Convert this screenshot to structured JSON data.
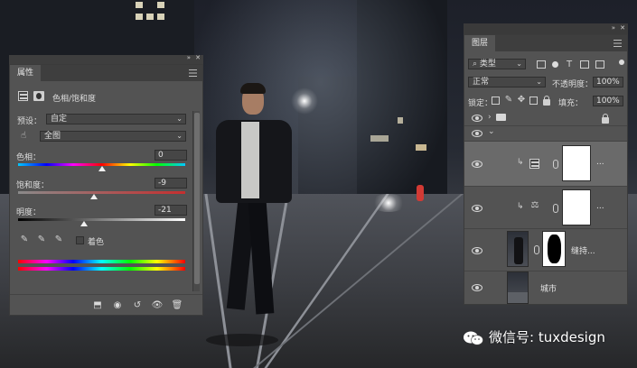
{
  "properties_panel": {
    "tab_label": "属性",
    "adjustment_name": "色相/饱和度",
    "preset_label": "预设：",
    "preset_value": "自定",
    "channel_value": "全图",
    "hue_label": "色相：",
    "hue_value": "0",
    "hue_level": 0.5,
    "saturation_label": "饱和度：",
    "saturation_value": "-9",
    "saturation_level": 0.455,
    "lightness_label": "明度：",
    "lightness_value": "-21",
    "lightness_level": 0.395,
    "colorize_label": "着色",
    "colorize_checked": false,
    "colors": {
      "panel_bg": "#535353",
      "tab_bar": "#3e3e3e",
      "field_bg": "#464646"
    },
    "icons": [
      "hue-saturation-adjustment-icon",
      "mask-icon",
      "target-adjust-hand-icon",
      "eyedropper-icon",
      "eyedropper-plus-icon",
      "eyedropper-minus-icon",
      "clip-to-layer-icon",
      "view-previous-state-icon",
      "reset-icon",
      "visibility-icon",
      "delete-icon"
    ]
  },
  "layers_panel": {
    "tab_label": "图层",
    "filter_kind": "类型",
    "blend_mode": "正常",
    "opacity_label": "不透明度：",
    "opacity_value": "100%",
    "lock_label": "锁定：",
    "fill_label": "填充：",
    "fill_value": "100%",
    "layers": [
      {
        "type": "group",
        "name": "",
        "expanded": false,
        "locked": true
      },
      {
        "type": "group",
        "name": "",
        "expanded": true,
        "locked": false
      },
      {
        "type": "adjustment",
        "name": "...",
        "clipped": true,
        "selected": true
      },
      {
        "type": "adjustment",
        "name": "...",
        "clipped": true,
        "selected": false
      },
      {
        "type": "pixel",
        "name": "缝持...",
        "clipped": false,
        "selected": false
      },
      {
        "type": "pixel",
        "name": "城市",
        "clipped": false,
        "selected": false
      }
    ]
  },
  "watermark": {
    "text": "微信号: tuxdesign"
  }
}
